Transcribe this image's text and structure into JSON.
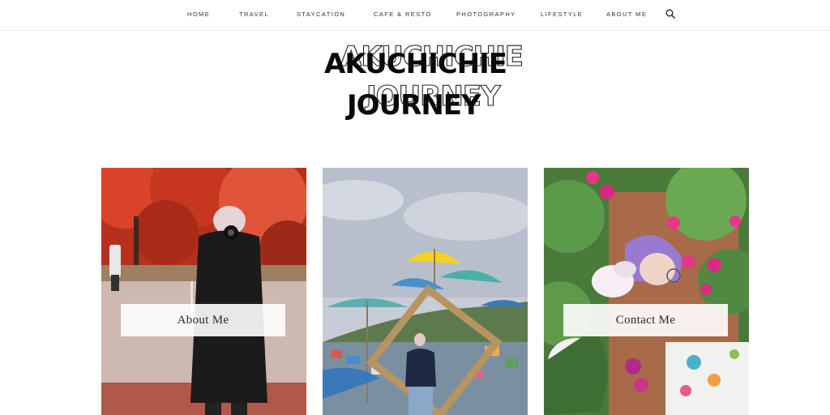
{
  "nav": {
    "items": [
      {
        "label": "HOME"
      },
      {
        "label": "TRAVEL"
      },
      {
        "label": "STAYCATION"
      },
      {
        "label": "CAFE & RESTO"
      },
      {
        "label": "PHOTOGRAPHY"
      },
      {
        "label": "LIFESTYLE"
      },
      {
        "label": "ABOUT ME"
      }
    ],
    "search_icon": "search-icon"
  },
  "logo": {
    "line1": "AKUCHICHIE",
    "line2": "JOURNEY"
  },
  "cards": [
    {
      "label": "About Me",
      "photo": "autumn-red-trees-photographer"
    },
    {
      "label": "",
      "photo": "umbrella-village-frame"
    },
    {
      "label": "Contact Me",
      "photo": "pink-flowers-portrait"
    }
  ],
  "colors": {
    "nav_border": "#ececec",
    "text": "#222222"
  }
}
